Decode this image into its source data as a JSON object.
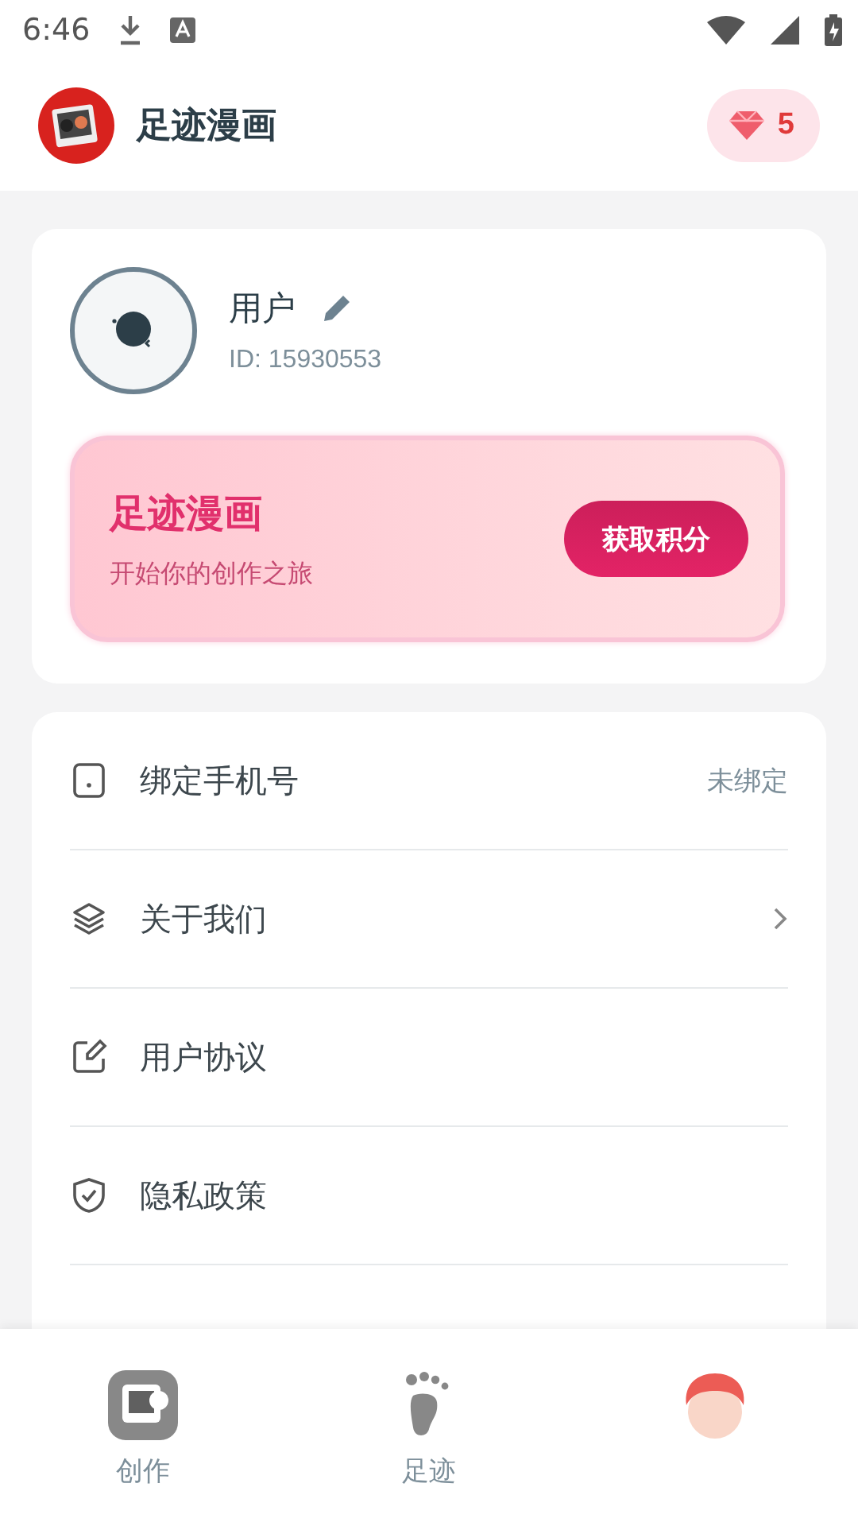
{
  "status_bar": {
    "time": "6:46"
  },
  "header": {
    "title": "足迹漫画",
    "gems": "5"
  },
  "profile": {
    "name": "用户",
    "id": "ID: 15930553"
  },
  "promo": {
    "title": "足迹漫画",
    "subtitle": "开始你的创作之旅",
    "button": "获取积分"
  },
  "menu": [
    {
      "kind": "phone",
      "label": "绑定手机号",
      "value": "未绑定",
      "chevron": false
    },
    {
      "kind": "layers",
      "label": "关于我们",
      "chevron": true
    },
    {
      "kind": "edit",
      "label": "用户协议",
      "chevron": false
    },
    {
      "kind": "shield",
      "label": "隐私政策",
      "chevron": false
    }
  ],
  "tabs": [
    {
      "kind": "create",
      "label": "创作",
      "selected": false
    },
    {
      "kind": "footprint",
      "label": "足迹",
      "selected": false
    },
    {
      "kind": "avatar",
      "selected": true
    }
  ]
}
